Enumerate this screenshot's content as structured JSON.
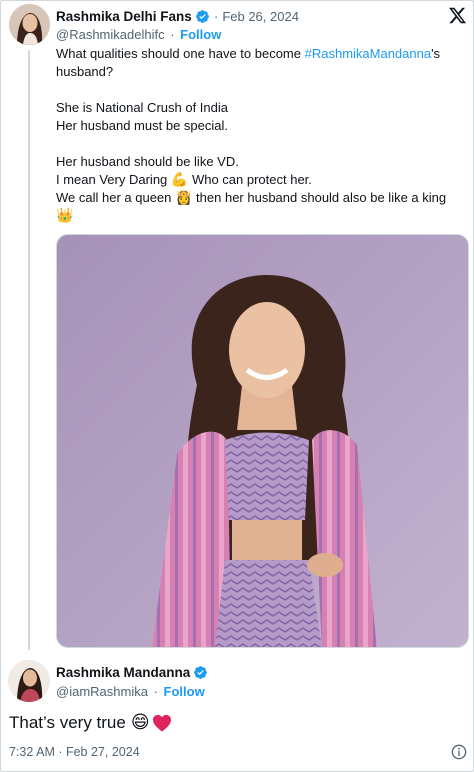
{
  "quoted_tweet": {
    "author_name": "Rashmika Delhi Fans",
    "date": "Feb 26, 2024",
    "handle": "@Rashmikadelhifc",
    "follow_label": "Follow",
    "lines": {
      "l1_pre": "What qualities should one have to become ",
      "l1_hashtag": "#RashmikaMandanna",
      "l1_post": "'s",
      "l2": "husband?",
      "l3": "She is National Crush of India",
      "l4": "Her husband must be special.",
      "l5": "Her husband should be like VD.",
      "l6_a": "I mean Very Daring ",
      "l6_emoji": "💪",
      "l6_b": " Who can protect her.",
      "l7_a": "We call her a queen ",
      "l7_emoji": "👸",
      "l7_b": " then her husband should also be like a king",
      "l8_emoji": "👑"
    },
    "photo": {
      "kind": "photo of woman in lavender chevron outfit with pink patterned jacket"
    }
  },
  "reply": {
    "author_name": "Rashmika Mandanna",
    "handle": "@iamRashmika",
    "follow_label": "Follow",
    "text": "That’s very true",
    "emoji": "😄",
    "timestamp": "7:32 AM · Feb 27, 2024"
  },
  "icons": {
    "verified": "verified-badge-icon",
    "x_logo": "x-logo-icon",
    "heart": "red-heart-icon",
    "info": "info-icon"
  },
  "colors": {
    "link": "#1d9bf0",
    "secondary_text": "#536471",
    "primary_text": "#0f1419",
    "heart": "#e0245e"
  }
}
